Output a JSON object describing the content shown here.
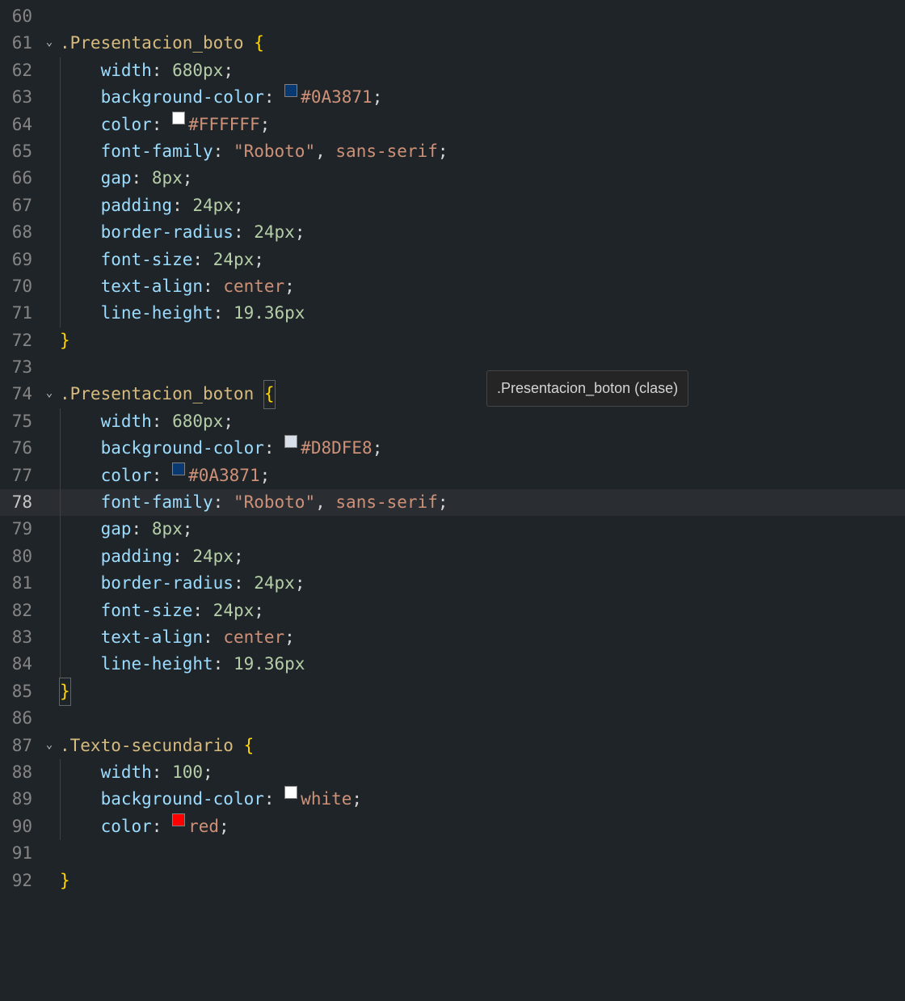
{
  "tooltip": ".Presentacion_boton (clase)",
  "colors": {
    "c1": "#0A3871",
    "c2": "#FFFFFF",
    "c3": "#D8DFE8",
    "c4": "#0A3871",
    "white": "#ffffff",
    "red": "#ff0000"
  },
  "lines": [
    {
      "n": "60",
      "fold": "",
      "guides": 0,
      "tokens": []
    },
    {
      "n": "61",
      "fold": "v",
      "guides": 0,
      "tokens": [
        {
          "t": ".Presentacion_boto",
          "c": "sel"
        },
        {
          "t": " ",
          "c": "punct"
        },
        {
          "t": "{",
          "c": "brace"
        }
      ]
    },
    {
      "n": "62",
      "fold": "",
      "guides": 1,
      "tokens": [
        {
          "t": "    ",
          "c": "punct"
        },
        {
          "t": "width",
          "c": "prop"
        },
        {
          "t": ": ",
          "c": "punct"
        },
        {
          "t": "680px",
          "c": "num"
        },
        {
          "t": ";",
          "c": "punct"
        }
      ]
    },
    {
      "n": "63",
      "fold": "",
      "guides": 1,
      "tokens": [
        {
          "t": "    ",
          "c": "punct"
        },
        {
          "t": "background-color",
          "c": "prop"
        },
        {
          "t": ": ",
          "c": "punct"
        },
        {
          "sw": "c1"
        },
        {
          "t": "#0A3871",
          "c": "kw"
        },
        {
          "t": ";",
          "c": "punct"
        }
      ]
    },
    {
      "n": "64",
      "fold": "",
      "guides": 1,
      "tokens": [
        {
          "t": "    ",
          "c": "punct"
        },
        {
          "t": "color",
          "c": "prop"
        },
        {
          "t": ": ",
          "c": "punct"
        },
        {
          "sw": "c2"
        },
        {
          "t": "#FFFFFF",
          "c": "kw"
        },
        {
          "t": ";",
          "c": "punct"
        }
      ]
    },
    {
      "n": "65",
      "fold": "",
      "guides": 1,
      "tokens": [
        {
          "t": "    ",
          "c": "punct"
        },
        {
          "t": "font-family",
          "c": "prop"
        },
        {
          "t": ": ",
          "c": "punct"
        },
        {
          "t": "\"Roboto\"",
          "c": "str"
        },
        {
          "t": ", ",
          "c": "punct"
        },
        {
          "t": "sans-serif",
          "c": "kw"
        },
        {
          "t": ";",
          "c": "punct"
        }
      ]
    },
    {
      "n": "66",
      "fold": "",
      "guides": 1,
      "tokens": [
        {
          "t": "    ",
          "c": "punct"
        },
        {
          "t": "gap",
          "c": "prop"
        },
        {
          "t": ": ",
          "c": "punct"
        },
        {
          "t": "8px",
          "c": "num"
        },
        {
          "t": ";",
          "c": "punct"
        }
      ]
    },
    {
      "n": "67",
      "fold": "",
      "guides": 1,
      "tokens": [
        {
          "t": "    ",
          "c": "punct"
        },
        {
          "t": "padding",
          "c": "prop"
        },
        {
          "t": ": ",
          "c": "punct"
        },
        {
          "t": "24px",
          "c": "num"
        },
        {
          "t": ";",
          "c": "punct"
        }
      ]
    },
    {
      "n": "68",
      "fold": "",
      "guides": 1,
      "tokens": [
        {
          "t": "    ",
          "c": "punct"
        },
        {
          "t": "border-radius",
          "c": "prop"
        },
        {
          "t": ": ",
          "c": "punct"
        },
        {
          "t": "24px",
          "c": "num"
        },
        {
          "t": ";",
          "c": "punct"
        }
      ]
    },
    {
      "n": "69",
      "fold": "",
      "guides": 1,
      "tokens": [
        {
          "t": "    ",
          "c": "punct"
        },
        {
          "t": "font-size",
          "c": "prop"
        },
        {
          "t": ": ",
          "c": "punct"
        },
        {
          "t": "24px",
          "c": "num"
        },
        {
          "t": ";",
          "c": "punct"
        }
      ]
    },
    {
      "n": "70",
      "fold": "",
      "guides": 1,
      "tokens": [
        {
          "t": "    ",
          "c": "punct"
        },
        {
          "t": "text-align",
          "c": "prop"
        },
        {
          "t": ": ",
          "c": "punct"
        },
        {
          "t": "center",
          "c": "kw"
        },
        {
          "t": ";",
          "c": "punct"
        }
      ]
    },
    {
      "n": "71",
      "fold": "",
      "guides": 1,
      "tokens": [
        {
          "t": "    ",
          "c": "punct"
        },
        {
          "t": "line-height",
          "c": "prop"
        },
        {
          "t": ": ",
          "c": "punct"
        },
        {
          "t": "19.36px",
          "c": "num"
        }
      ]
    },
    {
      "n": "72",
      "fold": "",
      "guides": 0,
      "tokens": [
        {
          "t": "}",
          "c": "brace"
        }
      ]
    },
    {
      "n": "73",
      "fold": "",
      "guides": 0,
      "tokens": []
    },
    {
      "n": "74",
      "fold": "v",
      "guides": 0,
      "tokens": [
        {
          "t": ".Presentacion_boton",
          "c": "sel"
        },
        {
          "t": " ",
          "c": "punct"
        },
        {
          "t": "{",
          "c": "brace",
          "match": true
        }
      ]
    },
    {
      "n": "75",
      "fold": "",
      "guides": 1,
      "tokens": [
        {
          "t": "    ",
          "c": "punct"
        },
        {
          "t": "width",
          "c": "prop"
        },
        {
          "t": ": ",
          "c": "punct"
        },
        {
          "t": "680px",
          "c": "num"
        },
        {
          "t": ";",
          "c": "punct"
        }
      ]
    },
    {
      "n": "76",
      "fold": "",
      "guides": 1,
      "tokens": [
        {
          "t": "    ",
          "c": "punct"
        },
        {
          "t": "background-color",
          "c": "prop"
        },
        {
          "t": ": ",
          "c": "punct"
        },
        {
          "sw": "c3"
        },
        {
          "t": "#D8DFE8",
          "c": "kw"
        },
        {
          "t": ";",
          "c": "punct"
        }
      ]
    },
    {
      "n": "77",
      "fold": "",
      "guides": 1,
      "tokens": [
        {
          "t": "    ",
          "c": "punct"
        },
        {
          "t": "color",
          "c": "prop"
        },
        {
          "t": ": ",
          "c": "punct"
        },
        {
          "sw": "c4"
        },
        {
          "t": "#0A3871",
          "c": "kw"
        },
        {
          "t": ";",
          "c": "punct"
        }
      ]
    },
    {
      "n": "78",
      "fold": "",
      "guides": 1,
      "current": true,
      "tokens": [
        {
          "t": "    ",
          "c": "punct"
        },
        {
          "t": "font-family",
          "c": "prop"
        },
        {
          "t": ": ",
          "c": "punct"
        },
        {
          "t": "\"Roboto\"",
          "c": "str"
        },
        {
          "t": ", ",
          "c": "punct"
        },
        {
          "t": "sans-serif",
          "c": "kw"
        },
        {
          "t": ";",
          "c": "punct"
        }
      ]
    },
    {
      "n": "79",
      "fold": "",
      "guides": 1,
      "tokens": [
        {
          "t": "    ",
          "c": "punct"
        },
        {
          "t": "gap",
          "c": "prop"
        },
        {
          "t": ": ",
          "c": "punct"
        },
        {
          "t": "8px",
          "c": "num"
        },
        {
          "t": ";",
          "c": "punct"
        }
      ]
    },
    {
      "n": "80",
      "fold": "",
      "guides": 1,
      "tokens": [
        {
          "t": "    ",
          "c": "punct"
        },
        {
          "t": "padding",
          "c": "prop"
        },
        {
          "t": ": ",
          "c": "punct"
        },
        {
          "t": "24px",
          "c": "num"
        },
        {
          "t": ";",
          "c": "punct"
        }
      ]
    },
    {
      "n": "81",
      "fold": "",
      "guides": 1,
      "tokens": [
        {
          "t": "    ",
          "c": "punct"
        },
        {
          "t": "border-radius",
          "c": "prop"
        },
        {
          "t": ": ",
          "c": "punct"
        },
        {
          "t": "24px",
          "c": "num"
        },
        {
          "t": ";",
          "c": "punct"
        }
      ]
    },
    {
      "n": "82",
      "fold": "",
      "guides": 1,
      "tokens": [
        {
          "t": "    ",
          "c": "punct"
        },
        {
          "t": "font-size",
          "c": "prop"
        },
        {
          "t": ": ",
          "c": "punct"
        },
        {
          "t": "24px",
          "c": "num"
        },
        {
          "t": ";",
          "c": "punct"
        }
      ]
    },
    {
      "n": "83",
      "fold": "",
      "guides": 1,
      "tokens": [
        {
          "t": "    ",
          "c": "punct"
        },
        {
          "t": "text-align",
          "c": "prop"
        },
        {
          "t": ": ",
          "c": "punct"
        },
        {
          "t": "center",
          "c": "kw"
        },
        {
          "t": ";",
          "c": "punct"
        }
      ]
    },
    {
      "n": "84",
      "fold": "",
      "guides": 1,
      "tokens": [
        {
          "t": "    ",
          "c": "punct"
        },
        {
          "t": "line-height",
          "c": "prop"
        },
        {
          "t": ": ",
          "c": "punct"
        },
        {
          "t": "19.36px",
          "c": "num"
        }
      ]
    },
    {
      "n": "85",
      "fold": "",
      "guides": 0,
      "tokens": [
        {
          "t": "}",
          "c": "brace",
          "match": true
        }
      ]
    },
    {
      "n": "86",
      "fold": "",
      "guides": 0,
      "tokens": []
    },
    {
      "n": "87",
      "fold": "v",
      "guides": 0,
      "tokens": [
        {
          "t": ".Texto-secundario",
          "c": "sel"
        },
        {
          "t": " ",
          "c": "punct"
        },
        {
          "t": "{",
          "c": "brace"
        }
      ]
    },
    {
      "n": "88",
      "fold": "",
      "guides": 1,
      "tokens": [
        {
          "t": "    ",
          "c": "punct"
        },
        {
          "t": "width",
          "c": "prop"
        },
        {
          "t": ": ",
          "c": "punct"
        },
        {
          "t": "100",
          "c": "num"
        },
        {
          "t": ";",
          "c": "punct"
        }
      ]
    },
    {
      "n": "89",
      "fold": "",
      "guides": 1,
      "tokens": [
        {
          "t": "    ",
          "c": "punct"
        },
        {
          "t": "background-color",
          "c": "prop"
        },
        {
          "t": ": ",
          "c": "punct"
        },
        {
          "sw": "white"
        },
        {
          "t": "white",
          "c": "kw"
        },
        {
          "t": ";",
          "c": "punct"
        }
      ]
    },
    {
      "n": "90",
      "fold": "",
      "guides": 1,
      "tokens": [
        {
          "t": "    ",
          "c": "punct"
        },
        {
          "t": "color",
          "c": "prop"
        },
        {
          "t": ": ",
          "c": "punct"
        },
        {
          "sw": "red"
        },
        {
          "t": "red",
          "c": "kw"
        },
        {
          "t": ";",
          "c": "punct"
        }
      ]
    },
    {
      "n": "91",
      "fold": "",
      "guides": 1,
      "tokens": []
    },
    {
      "n": "92",
      "fold": "",
      "guides": 0,
      "tokens": [
        {
          "t": "}",
          "c": "brace"
        }
      ]
    }
  ]
}
